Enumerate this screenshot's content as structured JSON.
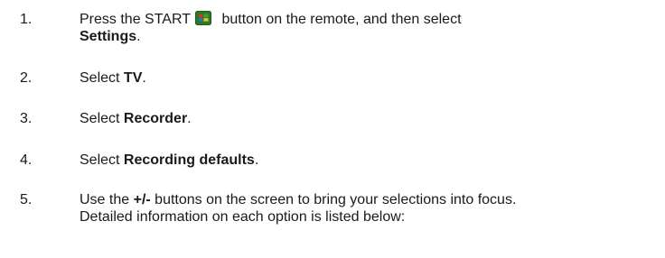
{
  "steps": [
    {
      "number": "1.",
      "text_before": "Press the START",
      "text_after": " button on the remote, and then select",
      "bold": "Settings",
      "suffix": ".",
      "icon": "start-button-icon"
    },
    {
      "number": "2.",
      "prefix": "Select ",
      "bold": "TV",
      "suffix": "."
    },
    {
      "number": "3.",
      "prefix": "Select ",
      "bold": "Recorder",
      "suffix": "."
    },
    {
      "number": "4.",
      "prefix": "Select ",
      "bold": "Recording defaults",
      "suffix": "."
    },
    {
      "number": "5.",
      "prefix": "Use the ",
      "bold": "+/-",
      "line1_rest": " buttons on the screen to bring your selections into focus.",
      "line2": "Detailed information on each option is listed below:"
    }
  ],
  "colors": {
    "text": "#1a1a1a",
    "icon_green": "#3aa53a",
    "icon_red": "#d83a2a",
    "icon_yellow": "#f2c21c",
    "icon_blue": "#2f6fd0"
  }
}
